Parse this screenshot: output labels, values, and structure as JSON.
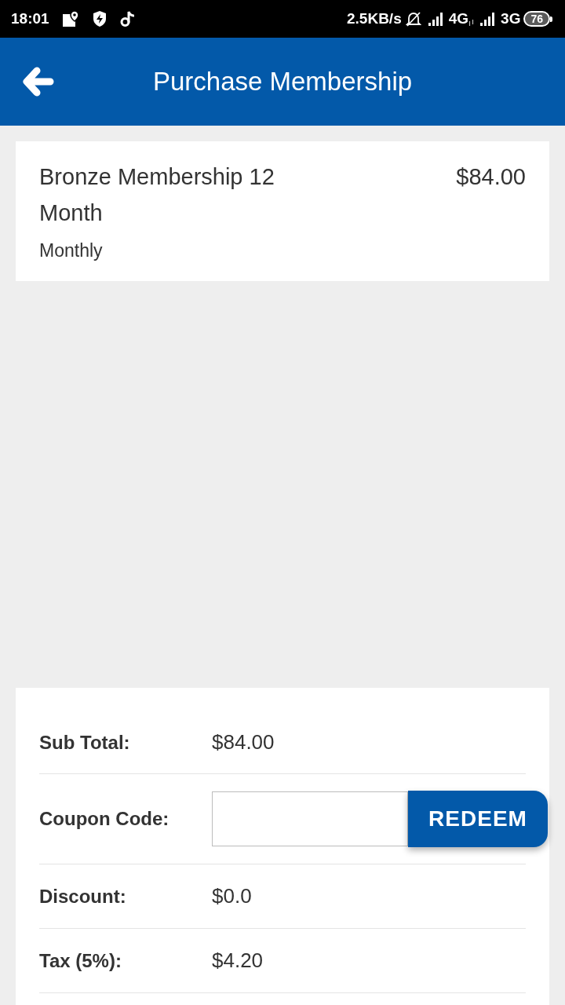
{
  "status_bar": {
    "time": "18:01",
    "network_speed": "2.5KB/s",
    "network_1": "4G",
    "network_2": "3G",
    "battery": "76"
  },
  "app_bar": {
    "title": "Purchase Membership"
  },
  "membership": {
    "name": "Bronze Membership 12 Month",
    "price": "$84.00",
    "billing": "Monthly"
  },
  "summary": {
    "rows": [
      {
        "kind": "value",
        "label": "Sub Total:",
        "value": "$84.00"
      },
      {
        "kind": "coupon",
        "label": "Coupon Code:",
        "button": "REDEEM"
      },
      {
        "kind": "value",
        "label": "Discount:",
        "value": "$0.0"
      },
      {
        "kind": "value",
        "label": "Tax (5%):",
        "value": "$4.20"
      }
    ]
  }
}
